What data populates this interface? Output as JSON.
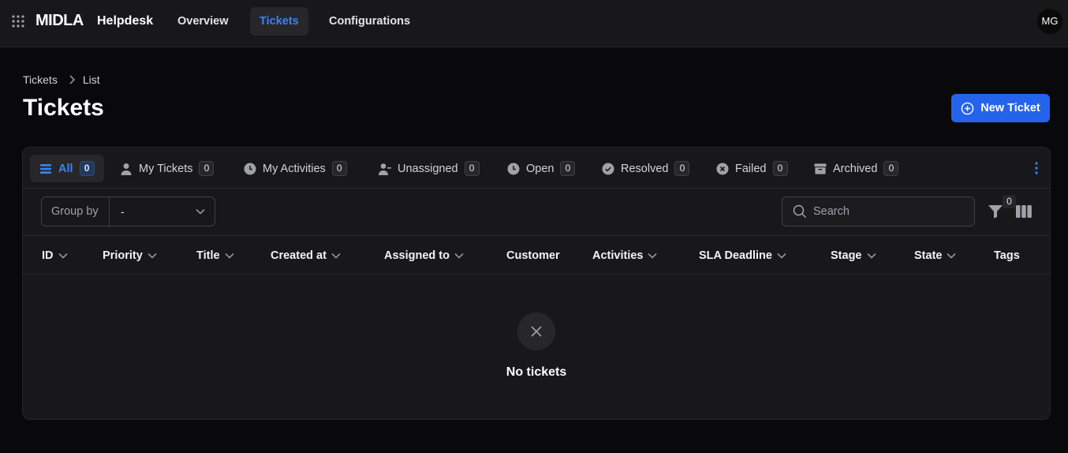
{
  "topbar": {
    "brand": "MIDLA",
    "app_name": "Helpdesk",
    "nav": [
      {
        "label": "Overview"
      },
      {
        "label": "Tickets",
        "active": true
      },
      {
        "label": "Configurations"
      }
    ],
    "avatar_initials": "MG"
  },
  "breadcrumb": [
    "Tickets",
    "List"
  ],
  "page_title": "Tickets",
  "new_ticket_label": "New Ticket",
  "tabs": [
    {
      "label": "All",
      "count": "0",
      "icon": "list-icon",
      "active": true
    },
    {
      "label": "My Tickets",
      "count": "0",
      "icon": "user-icon"
    },
    {
      "label": "My Activities",
      "count": "0",
      "icon": "clock-icon"
    },
    {
      "label": "Unassigned",
      "count": "0",
      "icon": "user-minus-icon"
    },
    {
      "label": "Open",
      "count": "0",
      "icon": "clock-icon"
    },
    {
      "label": "Resolved",
      "count": "0",
      "icon": "check-circle-icon"
    },
    {
      "label": "Failed",
      "count": "0",
      "icon": "x-circle-icon"
    },
    {
      "label": "Archived",
      "count": "0",
      "icon": "archive-icon"
    }
  ],
  "toolbar": {
    "group_by_label": "Group by",
    "group_by_value": "-",
    "search_placeholder": "Search",
    "filter_count": "0"
  },
  "columns": [
    "ID",
    "Priority",
    "Title",
    "Created at",
    "Assigned to",
    "Customer",
    "Activities",
    "SLA Deadline",
    "Stage",
    "State",
    "Tags"
  ],
  "empty_state": "No tickets",
  "colors": {
    "accent": "#2563eb",
    "active_tab_text": "#3b82f6",
    "background": "#09090b",
    "surface": "#18181b"
  }
}
